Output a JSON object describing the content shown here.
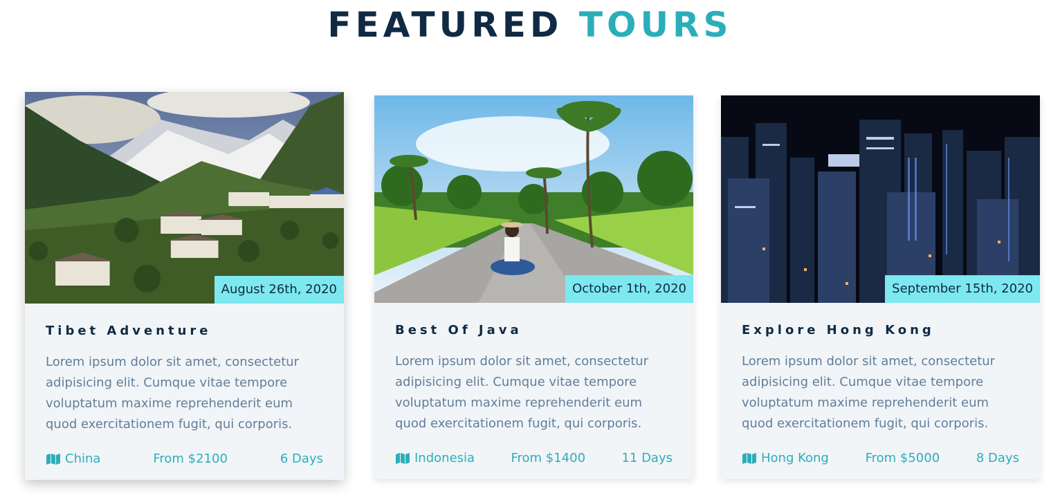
{
  "section": {
    "title_dark": "FEATURED",
    "title_accent": "TOURS"
  },
  "tours": [
    {
      "date": "August 26th, 2020",
      "name": "Tibet Adventure",
      "description": "Lorem ipsum dolor sit amet, consectetur adipisicing elit. Cumque vitae tempore voluptatum maxime reprehenderit eum quod exercitationem fugit, qui corporis.",
      "location": "China",
      "price": "From $2100",
      "duration": "6 Days"
    },
    {
      "date": "October 1th, 2020",
      "name": "Best Of Java",
      "description": "Lorem ipsum dolor sit amet, consectetur adipisicing elit. Cumque vitae tempore voluptatum maxime reprehenderit eum quod exercitationem fugit, qui corporis.",
      "location": "Indonesia",
      "price": "From $1400",
      "duration": "11 Days"
    },
    {
      "date": "September 15th, 2020",
      "name": "Explore Hong Kong",
      "description": "Lorem ipsum dolor sit amet, consectetur adipisicing elit. Cumque vitae tempore voluptatum maxime reprehenderit eum quod exercitationem fugit, qui corporis.",
      "location": "Hong Kong",
      "price": "From $5000",
      "duration": "8 Days"
    }
  ],
  "icons": {
    "location": "map-icon"
  },
  "colors": {
    "primary_dark": "#102a43",
    "accent": "#2caeba",
    "badge": "#7de8ef",
    "card_bg": "#f1f5f8",
    "text_muted": "#617d98"
  }
}
